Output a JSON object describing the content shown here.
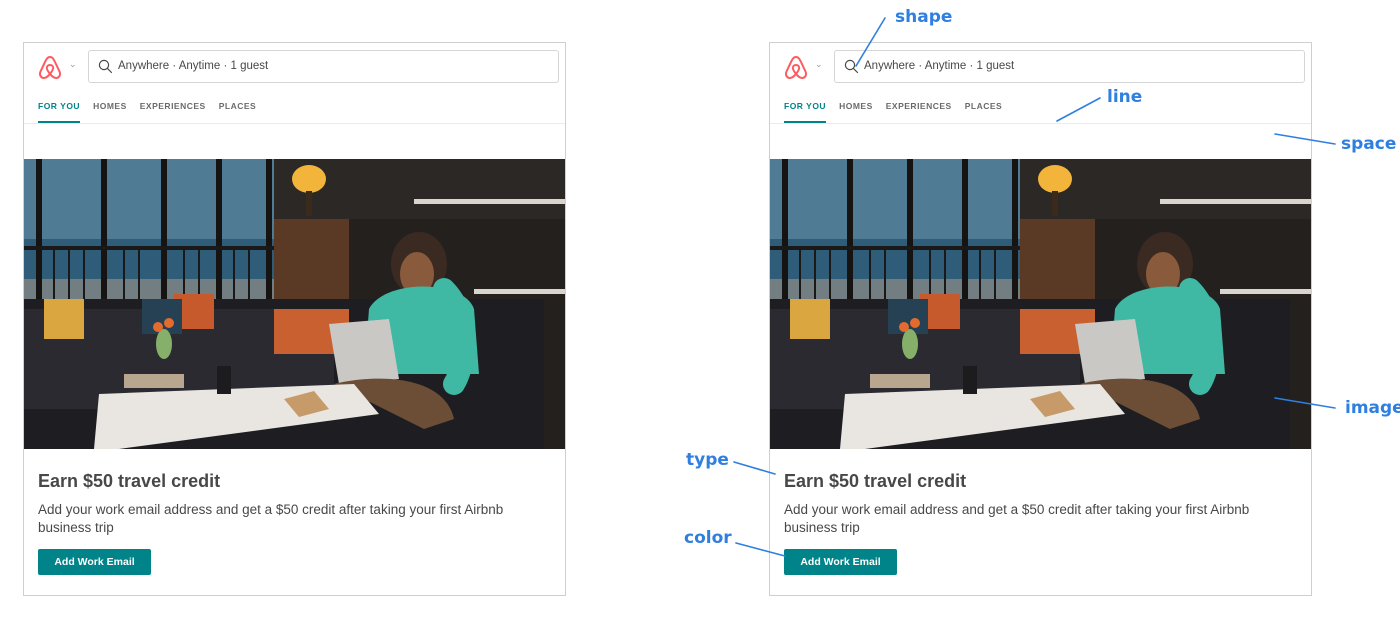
{
  "search": {
    "text": "Anywhere · Anytime · 1 guest"
  },
  "tabs": [
    {
      "label": "FOR YOU",
      "active": true
    },
    {
      "label": "HOMES",
      "active": false
    },
    {
      "label": "EXPERIENCES",
      "active": false
    },
    {
      "label": "PLACES",
      "active": false
    }
  ],
  "promo": {
    "title": "Earn $50 travel credit",
    "description": "Add your work email address and get a $50 credit after taking your first Airbnb business trip",
    "button_label": "Add Work Email"
  },
  "annotations": {
    "shape": "shape",
    "line": "line",
    "space": "space",
    "image": "image",
    "type": "type",
    "color": "color"
  },
  "colors": {
    "brand": "#ff5a5f",
    "accent": "#00848a",
    "annotation": "#2e7fe0"
  },
  "icons": {
    "logo": "airbnb-logo-icon",
    "caret": "chevron-down-icon",
    "search": "search-icon"
  }
}
